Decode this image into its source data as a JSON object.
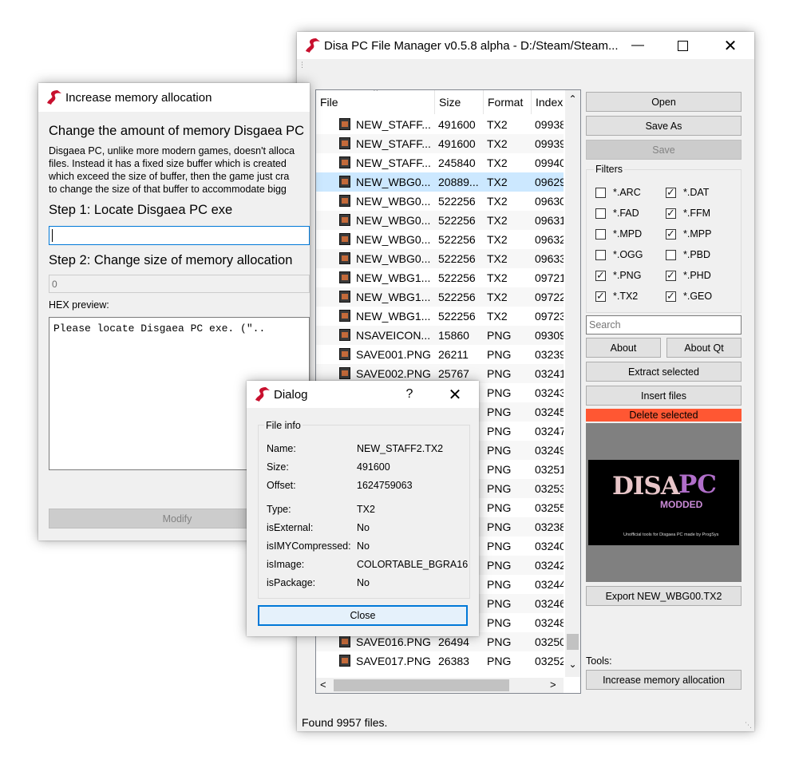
{
  "main_window": {
    "title": "Disa PC File Manager v0.5.8 alpha - D:/Steam/Steam...",
    "columns": [
      "File",
      "Size",
      "Format",
      "Index"
    ],
    "rows": [
      {
        "file": "NEW_STAFF...",
        "size": "491600",
        "format": "TX2",
        "index": "09938"
      },
      {
        "file": "NEW_STAFF...",
        "size": "491600",
        "format": "TX2",
        "index": "09939"
      },
      {
        "file": "NEW_STAFF...",
        "size": "245840",
        "format": "TX2",
        "index": "09940"
      },
      {
        "file": "NEW_WBG0...",
        "size": "20889...",
        "format": "TX2",
        "index": "09629"
      },
      {
        "file": "NEW_WBG0...",
        "size": "522256",
        "format": "TX2",
        "index": "09630"
      },
      {
        "file": "NEW_WBG0...",
        "size": "522256",
        "format": "TX2",
        "index": "09631"
      },
      {
        "file": "NEW_WBG0...",
        "size": "522256",
        "format": "TX2",
        "index": "09632"
      },
      {
        "file": "NEW_WBG0...",
        "size": "522256",
        "format": "TX2",
        "index": "09633"
      },
      {
        "file": "NEW_WBG1...",
        "size": "522256",
        "format": "TX2",
        "index": "09721"
      },
      {
        "file": "NEW_WBG1...",
        "size": "522256",
        "format": "TX2",
        "index": "09722"
      },
      {
        "file": "NEW_WBG1...",
        "size": "522256",
        "format": "TX2",
        "index": "09723"
      },
      {
        "file": "NSAVEICON....",
        "size": "15860",
        "format": "PNG",
        "index": "09309"
      },
      {
        "file": "SAVE001.PNG",
        "size": "26211",
        "format": "PNG",
        "index": "03239"
      },
      {
        "file": "SAVE002.PNG",
        "size": "25767",
        "format": "PNG",
        "index": "03241"
      },
      {
        "file": "",
        "size": "",
        "format": "PNG",
        "index": "03243"
      },
      {
        "file": "",
        "size": "",
        "format": "PNG",
        "index": "03245"
      },
      {
        "file": "",
        "size": "",
        "format": "PNG",
        "index": "03247"
      },
      {
        "file": "",
        "size": "",
        "format": "PNG",
        "index": "03249"
      },
      {
        "file": "",
        "size": "",
        "format": "PNG",
        "index": "03251"
      },
      {
        "file": "",
        "size": "",
        "format": "PNG",
        "index": "03253"
      },
      {
        "file": "",
        "size": "",
        "format": "PNG",
        "index": "03255"
      },
      {
        "file": "",
        "size": "",
        "format": "PNG",
        "index": "03238"
      },
      {
        "file": "",
        "size": "",
        "format": "PNG",
        "index": "03240"
      },
      {
        "file": "",
        "size": "",
        "format": "PNG",
        "index": "03242"
      },
      {
        "file": "",
        "size": "",
        "format": "PNG",
        "index": "03244"
      },
      {
        "file": "",
        "size": "",
        "format": "PNG",
        "index": "03246"
      },
      {
        "file": "",
        "size": "",
        "format": "PNG",
        "index": "03248"
      },
      {
        "file": "SAVE016.PNG",
        "size": "26494",
        "format": "PNG",
        "index": "03250"
      },
      {
        "file": "SAVE017.PNG",
        "size": "26383",
        "format": "PNG",
        "index": "03252"
      }
    ],
    "selected_row": 3,
    "buttons": {
      "open": "Open",
      "save_as": "Save As",
      "save": "Save",
      "about": "About",
      "about_qt": "About Qt",
      "extract": "Extract selected",
      "insert": "Insert files",
      "delete": "Delete selected",
      "export": "Export NEW_WBG00.TX2",
      "increase_memory": "Increase memory allocation"
    },
    "filters_label": "Filters",
    "filters": [
      {
        "label": "*.ARC",
        "checked": false
      },
      {
        "label": "*.DAT",
        "checked": true
      },
      {
        "label": "*.FAD",
        "checked": false
      },
      {
        "label": "*.FFM",
        "checked": true
      },
      {
        "label": "*.MPD",
        "checked": false
      },
      {
        "label": "*.MPP",
        "checked": true
      },
      {
        "label": "*.OGG",
        "checked": false
      },
      {
        "label": "*.PBD",
        "checked": false
      },
      {
        "label": "*.PNG",
        "checked": true
      },
      {
        "label": "*.PHD",
        "checked": true
      },
      {
        "label": "*.TX2",
        "checked": true
      },
      {
        "label": "*.GEO",
        "checked": true
      }
    ],
    "search_placeholder": "Search",
    "preview_title_1": "DISA",
    "preview_title_2": "PC",
    "preview_modded": "MODDED",
    "preview_caption": "Unofficial tools for Disgaea PC made by ProgSys",
    "tools_label": "Tools:",
    "status": "Found 9957 files.",
    "delete_color": "#ff5733"
  },
  "memory_window": {
    "title": "Increase memory allocation",
    "heading": "Change the amount of memory Disgaea PC",
    "desc_lines": [
      "Disgaea PC, unlike more modern games, doesn't alloca",
      "files. Instead it has a fixed size buffer which is created",
      "which exceed the size of buffer, then the game just cra",
      "to change the size of that buffer to accommodate bigg"
    ],
    "step1": "Step 1: Locate Disgaea PC exe",
    "step2": "Step 2: Change size of memory allocation",
    "size_value": "0",
    "hex_label": "HEX preview:",
    "hex_text": "Please locate Disgaea PC exe. (\"..",
    "modify": "Modify"
  },
  "dialog": {
    "title": "Dialog",
    "help": "?",
    "group": "File info",
    "fields": [
      {
        "key": "Name:",
        "value": "NEW_STAFF2.TX2"
      },
      {
        "key": "Size:",
        "value": "491600"
      },
      {
        "key": "Offset:",
        "value": "1624759063"
      },
      {
        "key": "Type:",
        "value": "TX2"
      },
      {
        "key": "isExternal:",
        "value": "No"
      },
      {
        "key": "isIMYCompressed:",
        "value": "No"
      },
      {
        "key": "isImage:",
        "value": "COLORTABLE_BGRA16"
      },
      {
        "key": "isPackage:",
        "value": "No"
      }
    ],
    "close": "Close"
  }
}
